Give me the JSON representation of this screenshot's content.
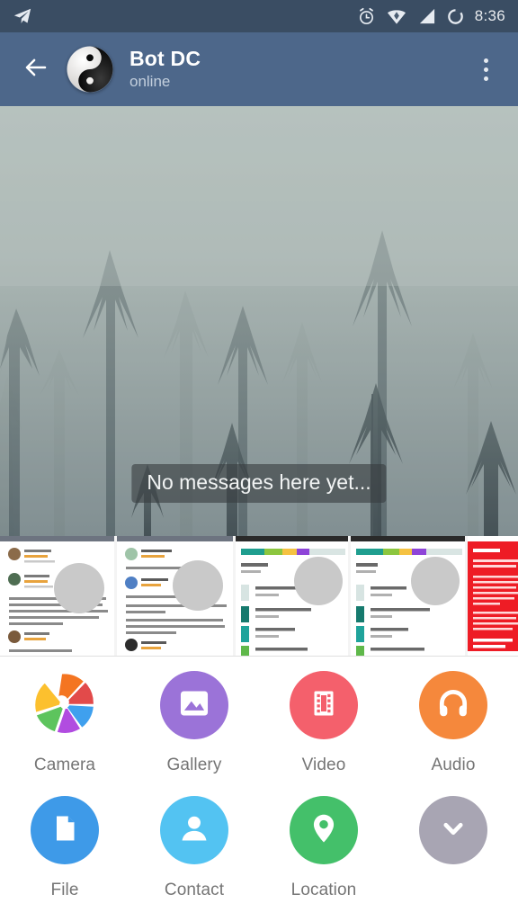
{
  "statusbar": {
    "time": "8:36",
    "icons": [
      "telegram-plane-icon",
      "alarm-clock-icon",
      "wifi-icon",
      "signal-icon",
      "battery-icon"
    ],
    "background": "#3a4d63"
  },
  "appbar": {
    "back_icon": "back-arrow-icon",
    "avatar_icon": "yin-yang-avatar",
    "title": "Bot DC",
    "status": "online",
    "menu_icon": "overflow-menu-icon",
    "background": "#4d678a"
  },
  "chat": {
    "empty_text": "No messages here yet...",
    "wallpaper": "foggy-pine-forest"
  },
  "photo_strip": {
    "thumbnails": [
      {
        "name": "app-reviews-screenshot-1",
        "width": 130
      },
      {
        "name": "app-reviews-screenshot-2",
        "width": 132
      },
      {
        "name": "storage-usage-screenshot-1",
        "width": 128
      },
      {
        "name": "storage-usage-screenshot-2",
        "width": 130
      },
      {
        "name": "red-warning-screenshot",
        "width": 62
      }
    ]
  },
  "attachment_menu": {
    "rows": [
      [
        {
          "label": "Camera",
          "icon": "camera-shutter-icon",
          "color": "#ffffff"
        },
        {
          "label": "Gallery",
          "icon": "gallery-image-icon",
          "color": "#9b73d8"
        },
        {
          "label": "Video",
          "icon": "video-film-icon",
          "color": "#f4606c"
        },
        {
          "label": "Audio",
          "icon": "audio-headphones-icon",
          "color": "#f5883c"
        }
      ],
      [
        {
          "label": "File",
          "icon": "file-document-icon",
          "color": "#3e9ae8"
        },
        {
          "label": "Contact",
          "icon": "contact-person-icon",
          "color": "#53c3f2"
        },
        {
          "label": "Location",
          "icon": "location-pin-icon",
          "color": "#44c06a"
        },
        {
          "label": "",
          "icon": "chevron-down-icon",
          "color": "#a8a5b3"
        }
      ]
    ]
  }
}
